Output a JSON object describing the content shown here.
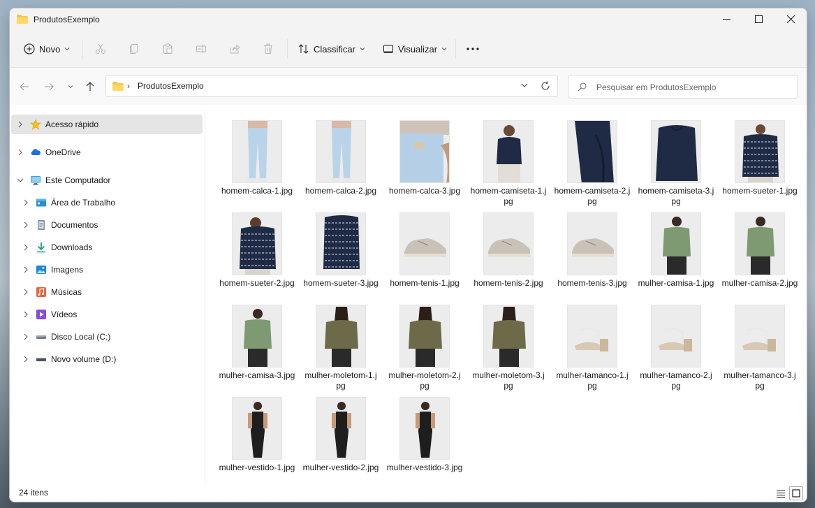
{
  "window": {
    "title": "ProdutosExemplo"
  },
  "toolbar": {
    "new_label": "Novo",
    "sort_label": "Classificar",
    "view_label": "Visualizar"
  },
  "address": {
    "path": "ProdutosExemplo"
  },
  "search": {
    "placeholder": "Pesquisar em ProdutosExemplo"
  },
  "sidebar": {
    "items": [
      {
        "label": "Acesso rápido",
        "icon": "star-icon"
      },
      {
        "label": "OneDrive",
        "icon": "cloud-icon"
      },
      {
        "label": "Este Computador",
        "icon": "computer-icon"
      },
      {
        "label": "Área de Trabalho",
        "icon": "desktop-icon"
      },
      {
        "label": "Documentos",
        "icon": "document-icon"
      },
      {
        "label": "Downloads",
        "icon": "download-icon"
      },
      {
        "label": "Imagens",
        "icon": "image-icon"
      },
      {
        "label": "Músicas",
        "icon": "music-icon"
      },
      {
        "label": "Vídeos",
        "icon": "video-icon"
      },
      {
        "label": "Disco Local (C:)",
        "icon": "drive-icon"
      },
      {
        "label": "Novo volume (D:)",
        "icon": "drive-icon"
      }
    ]
  },
  "files": [
    {
      "name": "homem-calca-1.jpg",
      "kind": "pants"
    },
    {
      "name": "homem-calca-2.jpg",
      "kind": "pants"
    },
    {
      "name": "homem-calca-3.jpg",
      "kind": "pants-close"
    },
    {
      "name": "homem-camiseta-1.jpg",
      "kind": "man-navy"
    },
    {
      "name": "homem-camiseta-2.jpg",
      "kind": "sleeve-navy"
    },
    {
      "name": "homem-camiseta-3.jpg",
      "kind": "shirt-navy"
    },
    {
      "name": "homem-sueter-1.jpg",
      "kind": "sweater"
    },
    {
      "name": "homem-sueter-2.jpg",
      "kind": "sweater-side"
    },
    {
      "name": "homem-sueter-3.jpg",
      "kind": "sweater-flat"
    },
    {
      "name": "homem-tenis-1.jpg",
      "kind": "sneaker"
    },
    {
      "name": "homem-tenis-2.jpg",
      "kind": "sneaker"
    },
    {
      "name": "homem-tenis-3.jpg",
      "kind": "sneaker"
    },
    {
      "name": "mulher-camisa-1.jpg",
      "kind": "woman-green"
    },
    {
      "name": "mulher-camisa-2.jpg",
      "kind": "woman-green-back"
    },
    {
      "name": "mulher-camisa-3.jpg",
      "kind": "woman-green-close"
    },
    {
      "name": "mulher-moletom-1.jpg",
      "kind": "woman-olive"
    },
    {
      "name": "mulher-moletom-2.jpg",
      "kind": "woman-olive-back"
    },
    {
      "name": "mulher-moletom-3.jpg",
      "kind": "woman-olive-close"
    },
    {
      "name": "mulher-tamanco-1.jpg",
      "kind": "heel"
    },
    {
      "name": "mulher-tamanco-2.jpg",
      "kind": "heel"
    },
    {
      "name": "mulher-tamanco-3.jpg",
      "kind": "heel-side"
    },
    {
      "name": "mulher-vestido-1.jpg",
      "kind": "jumpsuit"
    },
    {
      "name": "mulher-vestido-2.jpg",
      "kind": "jumpsuit"
    },
    {
      "name": "mulher-vestido-3.jpg",
      "kind": "jumpsuit-close"
    }
  ],
  "status": {
    "count_text": "24 itens"
  },
  "colors": {
    "accent": "#0067c0",
    "folder": "#f8c74a",
    "selection": "#e5e5e5"
  }
}
